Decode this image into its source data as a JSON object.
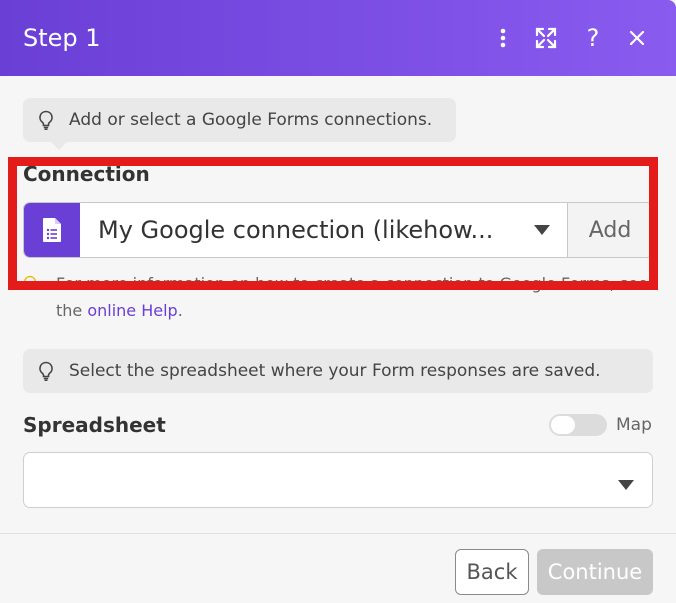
{
  "header": {
    "title": "Step 1",
    "icons": [
      "more-vertical-icon",
      "expand-icon",
      "help-icon",
      "close-icon"
    ]
  },
  "connection_tip": "Add or select a Google Forms connections.",
  "connection": {
    "label": "Connection",
    "value": "My Google connection (likehow...",
    "add_label": "Add",
    "help_text": "For more information on how to create a connection to Google Forms, see the ",
    "help_link": "online Help",
    "help_end": "."
  },
  "spreadsheet_tip": "Select the spreadsheet where your Form responses are saved.",
  "spreadsheet": {
    "label": "Spreadsheet",
    "map_label": "Map",
    "value": ""
  },
  "footer": {
    "back_label": "Back",
    "continue_label": "Continue"
  },
  "colors": {
    "accent": "#6a3fd6",
    "highlight": "#e31b1b"
  }
}
